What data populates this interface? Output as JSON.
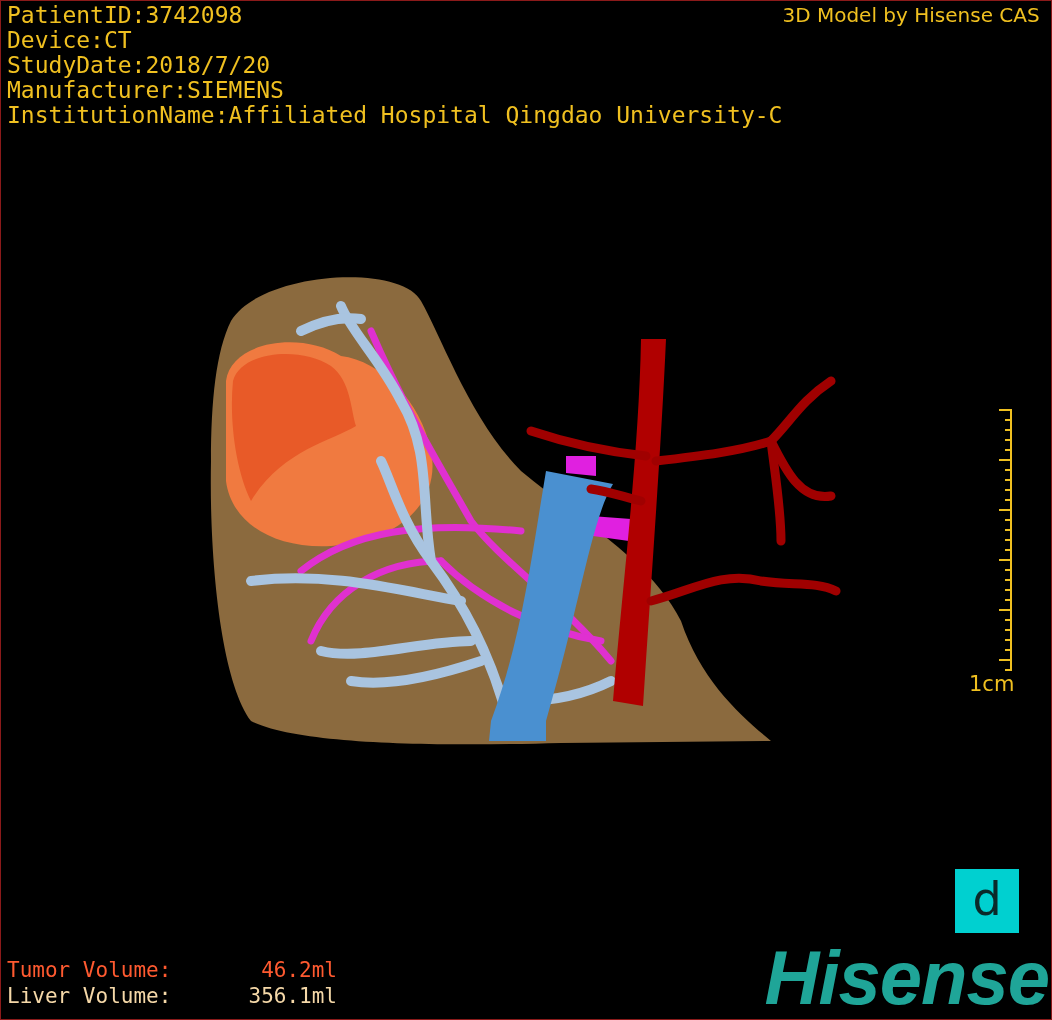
{
  "header": {
    "info_lines": [
      "PatientID:3742098",
      "Device:CT",
      "StudyDate:2018/7/20",
      "Manufacturer:SIEMENS",
      "InstitutionName:Affiliated Hospital Qingdao University-C"
    ],
    "credit": "3D Model by Hisense CAS"
  },
  "scale_bar": {
    "label": "1cm"
  },
  "volumes": [
    {
      "kind": "tumor",
      "label": "Tumor Volume:",
      "value": "46.2ml"
    },
    {
      "kind": "liver",
      "label": "Liver Volume:",
      "value": "356.1ml"
    }
  ],
  "logo": {
    "badge": "d",
    "brand": "Hisense"
  }
}
